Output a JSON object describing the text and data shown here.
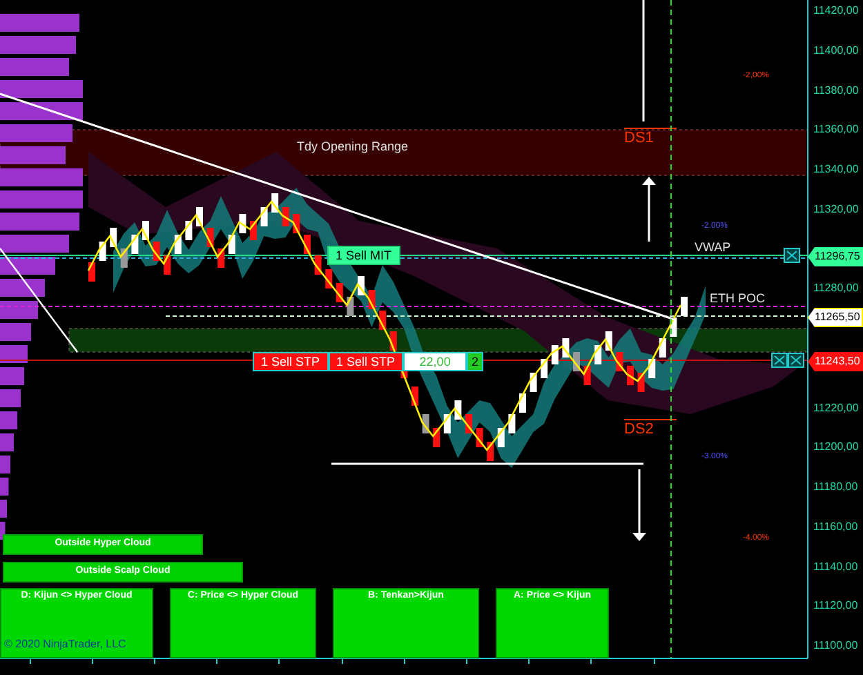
{
  "price_axis": {
    "ticks": [
      "11420,00",
      "11400,00",
      "11380,00",
      "11360,00",
      "11340,00",
      "11320,00",
      "11280,00",
      "11220,00",
      "11200,00",
      "11180,00",
      "11160,00",
      "11140,00",
      "11120,00",
      "11100,00"
    ]
  },
  "price_markers": [
    {
      "label": "11296,75",
      "kind": "mit"
    },
    {
      "label": "11265,50",
      "kind": "last"
    },
    {
      "label": "11243,50",
      "kind": "stop"
    }
  ],
  "chart_labels": [
    {
      "text": "Tdy Opening Range",
      "kind": "range"
    },
    {
      "text": "DS1",
      "kind": "level"
    },
    {
      "text": "VWAP",
      "kind": "line"
    },
    {
      "text": "ETH POC",
      "kind": "line"
    },
    {
      "text": "DS2",
      "kind": "level"
    }
  ],
  "percent_labels": [
    {
      "text": "-2,00%",
      "color": "#ff3300"
    },
    {
      "text": "-2.00%",
      "color": "#5555ff"
    },
    {
      "text": "-3.00%",
      "color": "#5555ff"
    },
    {
      "text": "-4.00%",
      "color": "#ff3300"
    }
  ],
  "orders": [
    {
      "label": "1 Sell MIT",
      "kind": "mit"
    },
    {
      "label": "1 Sell STP",
      "kind": "stp"
    },
    {
      "label": "1 Sell STP",
      "kind": "stp"
    }
  ],
  "order_quantity": {
    "value": "22,00",
    "count": "2"
  },
  "signal_bars": [
    {
      "label": "Outside Hyper Cloud"
    },
    {
      "label": "Outside Scalp Cloud"
    }
  ],
  "signal_boxes": [
    {
      "label": "D: Kijun <> Hyper Cloud"
    },
    {
      "label": "C: Price <> Hyper Cloud"
    },
    {
      "label": "B: Tenkan>Kijun"
    },
    {
      "label": "A: Price <> Kijun"
    }
  ],
  "copyright": "© 2020 NinjaTrader, LLC"
}
